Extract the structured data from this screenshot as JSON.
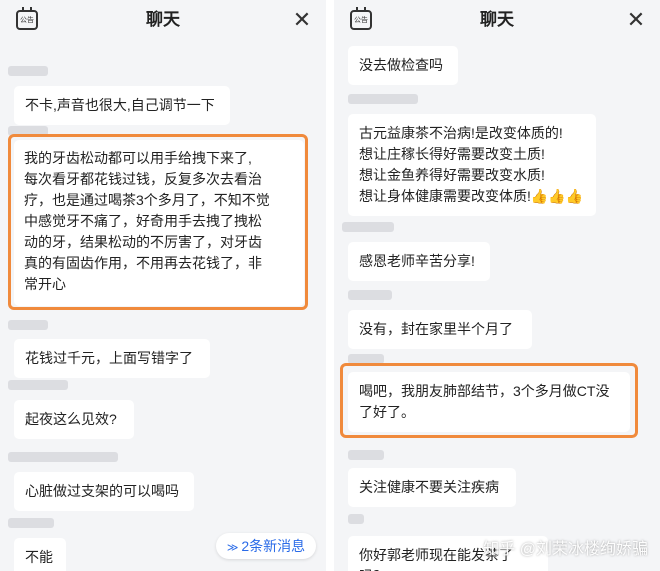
{
  "left": {
    "title": "聊天",
    "calendar_icon_text": "公告",
    "close_glyph": "✕",
    "messages": [
      {
        "text": "不卡,声音也很大,自己调节一下"
      },
      {
        "text": "我的牙齿松动都可以用手给拽下来了,\n每次看牙都花钱过钱，反复多次去看治\n疗，也是通过喝茶3个多月了，不知不觉\n中感觉牙不痛了，好奇用手去拽了拽松\n动的牙，结果松动的不厉害了，对牙齿\n真的有固齿作用，不用再去花钱了，非\n常开心"
      },
      {
        "text": "花钱过千元，上面写错字了"
      },
      {
        "text": "起夜这么见效?"
      },
      {
        "text": "心脏做过支架的可以喝吗"
      },
      {
        "text": "不能"
      }
    ],
    "new_messages_label": "2条新消息",
    "new_messages_chevron": "≫"
  },
  "right": {
    "title": "聊天",
    "calendar_icon_text": "公告",
    "close_glyph": "✕",
    "messages": [
      {
        "text": "没去做检查吗"
      },
      {
        "text": "古元益康茶不治病!是改变体质的!\n想让庄稼长得好需要改变土质!\n想让金鱼养得好需要改变水质!\n想让身体健康需要改变体质!👍👍👍"
      },
      {
        "text": "感恩老师辛苦分享!"
      },
      {
        "text": "没有，封在家里半个月了"
      },
      {
        "text": "喝吧，我朋友肺部结节，3个多月做CT没\n了好了。"
      },
      {
        "text": "关注健康不要关注疾病"
      },
      {
        "text": "你好郭老师现在能发茶了吗？"
      }
    ],
    "watermark": "知乎 @刘荣冰楼绚娇骗"
  },
  "colors": {
    "highlight": "#f08a3c",
    "new_message_text": "#2a6be8"
  }
}
